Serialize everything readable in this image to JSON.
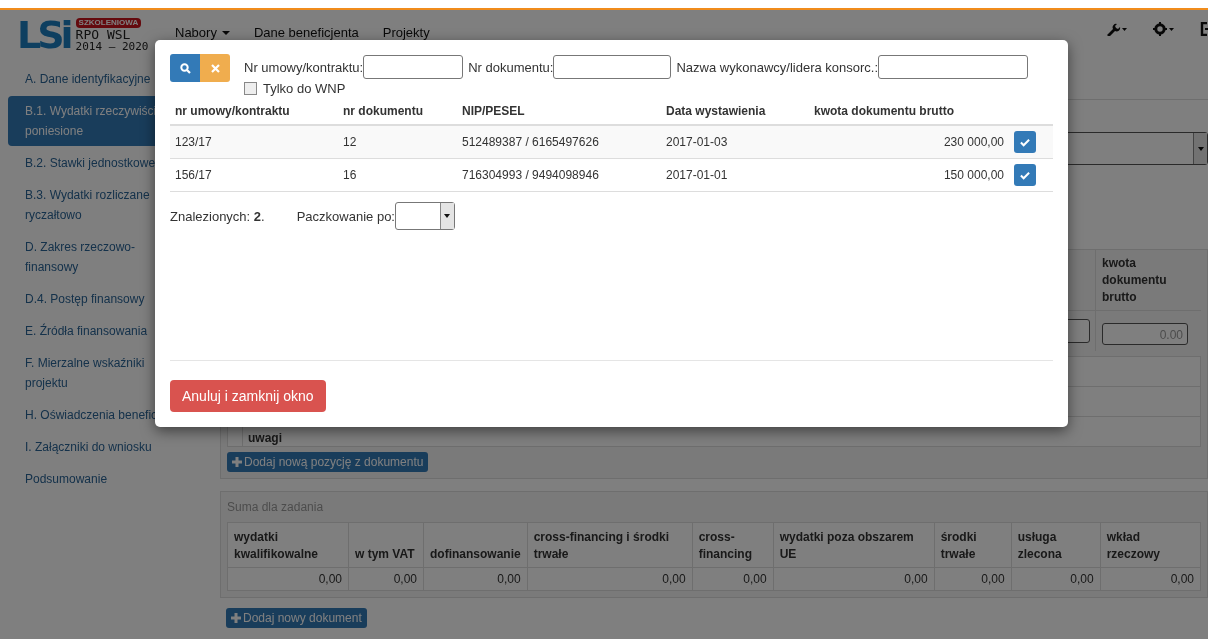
{
  "logo": {
    "mark": "LSi",
    "badge": "SZKOLENIOWA",
    "line1": "RPO WSL",
    "line2": "2014 – 2020"
  },
  "nav": [
    {
      "label": "Nabory",
      "dropdown": true
    },
    {
      "label": "Dane beneficjenta",
      "dropdown": false
    },
    {
      "label": "Projekty",
      "dropdown": false
    }
  ],
  "sidebar": [
    {
      "lines": [
        "A. Dane identyfikacyjne"
      ],
      "selected": false
    },
    {
      "lines": [
        "B.1. Wydatki rzeczywiści",
        "poniesione"
      ],
      "selected": true
    },
    {
      "lines": [
        "B.2. Stawki jednostkowe"
      ],
      "selected": false
    },
    {
      "lines": [
        "B.3. Wydatki rozliczane",
        "ryczałtowo"
      ],
      "selected": false
    },
    {
      "lines": [
        "D. Zakres rzeczowo-",
        "finansowy"
      ],
      "selected": false
    },
    {
      "lines": [
        "D.4. Postęp finansowy"
      ],
      "selected": false
    },
    {
      "lines": [
        "E. Źródła finansowania"
      ],
      "selected": false
    },
    {
      "lines": [
        "F. Mierzalne wskaźniki",
        "projektu"
      ],
      "selected": false
    },
    {
      "lines": [
        "H. Oświadczenia benefic"
      ],
      "selected": false
    },
    {
      "lines": [
        "I. Załączniki do wniosku"
      ],
      "selected": false
    },
    {
      "lines": [
        "Podsumowanie"
      ],
      "selected": false
    }
  ],
  "document_table": {
    "last_column": "kwota dokumentu brutto",
    "amount_value": "0.00",
    "notes_label": "uwagi",
    "add_item_button": "Dodaj nową pozycję z dokumentu"
  },
  "summary": {
    "title": "Suma dla zadania",
    "columns": [
      "wydatki kwalifikowalne",
      "w tym VAT",
      "dofinansowanie",
      "cross-financing i środki trwałe",
      "cross-financing",
      "wydatki poza obszarem UE",
      "środki trwałe",
      "usługa zlecona",
      "wkład rzeczowy"
    ],
    "values": [
      "0,00",
      "0,00",
      "0,00",
      "0,00",
      "0,00",
      "0,00",
      "0,00",
      "0,00",
      "0,00"
    ]
  },
  "add_document_button": "Dodaj nowy dokument",
  "modal": {
    "filters": [
      {
        "label": "Nr umowy/kontraktu:"
      },
      {
        "label": "Nr dokumentu:"
      },
      {
        "label": "Nazwa wykonawcy/lidera konsorc.:"
      }
    ],
    "only_wnp": {
      "label": "Tylko do WNP",
      "checked": false
    },
    "columns": [
      "nr umowy/kontraktu",
      "nr dokumentu",
      "NIP/PESEL",
      "Data wystawienia",
      "kwota dokumentu brutto"
    ],
    "rows": [
      {
        "cells": [
          "123/17",
          "12",
          "512489387 / 6165497626",
          "2017-01-03",
          "230 000,00"
        ]
      },
      {
        "cells": [
          "156/17",
          "16",
          "716304993 / 9494098946",
          "2017-01-01",
          "150 000,00"
        ]
      }
    ],
    "found_text": "Znalezionych: **2**.",
    "page_size_label": "Paczkowanie po:",
    "cancel_button": "Anuluj i zamknij okno"
  }
}
